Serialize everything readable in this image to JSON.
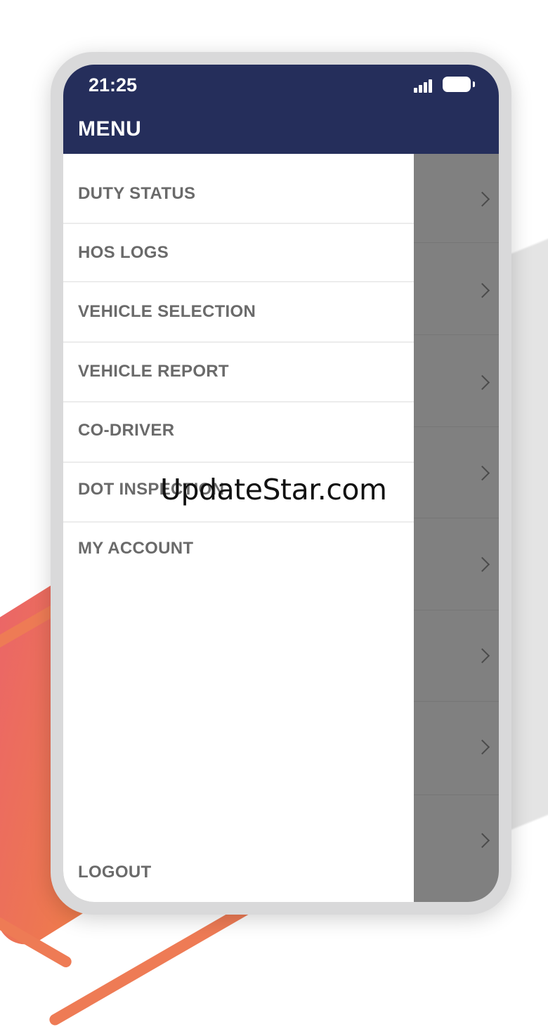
{
  "status_bar": {
    "time": "21:25",
    "signal_icon": "cellular-signal-icon",
    "battery_icon": "battery-icon"
  },
  "header": {
    "title": "MENU",
    "background_color": "#252e5b"
  },
  "drawer": {
    "items": [
      {
        "label": "DUTY STATUS"
      },
      {
        "label": "HOS LOGS"
      },
      {
        "label": "VEHICLE SELECTION"
      },
      {
        "label": "VEHICLE REPORT"
      },
      {
        "label": "CO-DRIVER"
      },
      {
        "label": "DOT INSPECTION"
      },
      {
        "label": "MY ACCOUNT"
      }
    ],
    "logout_label": "LOGOUT",
    "text_color": "#6a6a6a"
  },
  "underlay": {
    "row_count": 8,
    "chevron_icon": "chevron-right-icon",
    "overlay_color": "#808080"
  },
  "watermark": {
    "text": "UpdateStar.com"
  }
}
